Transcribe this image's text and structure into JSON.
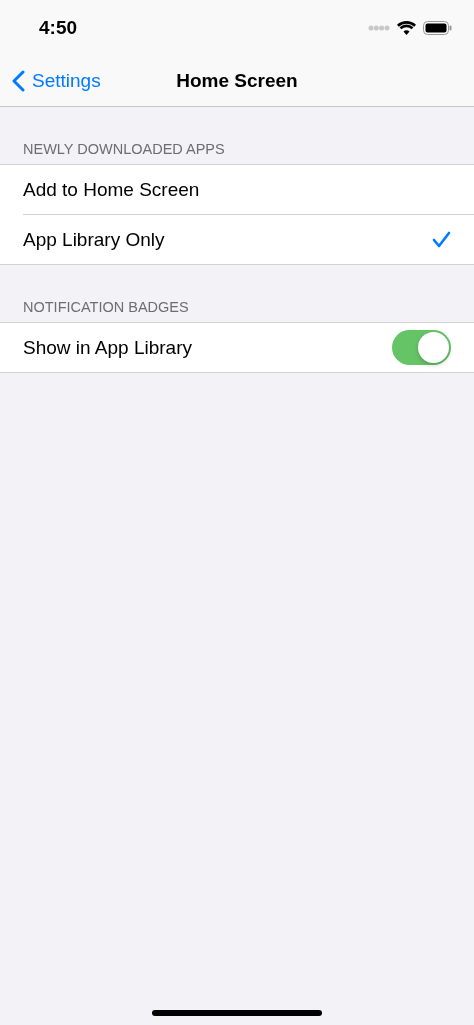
{
  "status_bar": {
    "time": "4:50"
  },
  "nav": {
    "back_label": "Settings",
    "title": "Home Screen"
  },
  "sections": [
    {
      "header": "NEWLY DOWNLOADED APPS",
      "rows": [
        {
          "kind": "choice",
          "label": "Add to Home Screen",
          "selected": false
        },
        {
          "kind": "choice",
          "label": "App Library Only",
          "selected": true
        }
      ]
    },
    {
      "header": "NOTIFICATION BADGES",
      "rows": [
        {
          "kind": "toggle",
          "label": "Show in App Library",
          "on": true
        }
      ]
    }
  ]
}
